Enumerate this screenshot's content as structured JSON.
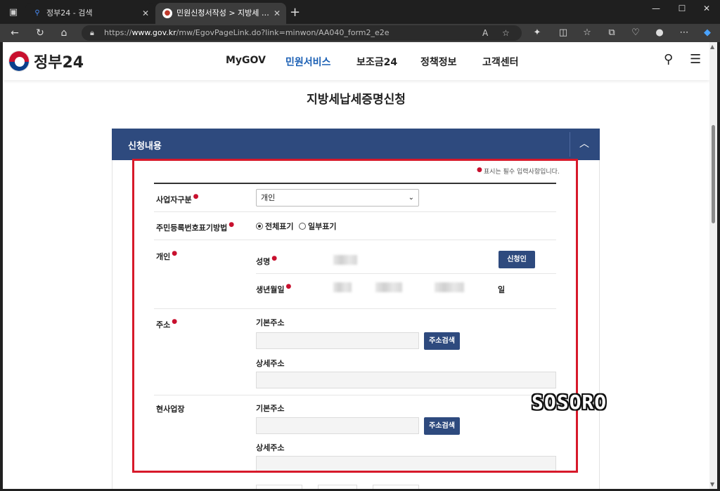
{
  "browser": {
    "tabs": [
      {
        "title": "정부24 - 검색",
        "active": false,
        "favicon": "search-icon"
      },
      {
        "title": "민원신청서작성 > 지방세 납세증",
        "active": true,
        "favicon": "gov24-favicon"
      }
    ],
    "url_prefix": "https://",
    "url_host": "www.gov.kr",
    "url_path": "/mw/EgovPageLink.do?link=minwon/AA040_form2_e2e",
    "window_controls": [
      "minimize",
      "maximize",
      "close"
    ]
  },
  "site": {
    "logo_text": "정부24",
    "nav": [
      {
        "label": "MyGOV",
        "active": false
      },
      {
        "label": "민원서비스",
        "active": true
      },
      {
        "label": "보조금24",
        "active": false
      },
      {
        "label": "정책정보",
        "active": false
      },
      {
        "label": "고객센터",
        "active": false
      }
    ],
    "accent_color": "#1a5fb4",
    "panel_color": "#2e4a7e"
  },
  "form": {
    "page_title": "지방세납세증명신청",
    "section_title": "신청내용",
    "required_note": "표시는 필수 입력사항입니다.",
    "applicant_type": {
      "label": "사업자구분",
      "value": "개인"
    },
    "id_display": {
      "label": "주민등록번호표기방법",
      "options": [
        {
          "label": "전체표기",
          "checked": true
        },
        {
          "label": "일부표기",
          "checked": false
        }
      ]
    },
    "personal": {
      "label": "개인",
      "name_label": "성명",
      "applicant_button": "신청인",
      "birth_label": "생년월일",
      "day_suffix": "일"
    },
    "address": {
      "label": "주소",
      "basic_label": "기본주소",
      "search_button": "주소검색",
      "detail_label": "상세주소"
    },
    "workplace": {
      "label": "현사업장",
      "basic_label": "기본주소",
      "search_button": "주소검색",
      "detail_label": "상세주소"
    }
  },
  "watermark": "SOSORO",
  "highlight_color": "#d7192a"
}
